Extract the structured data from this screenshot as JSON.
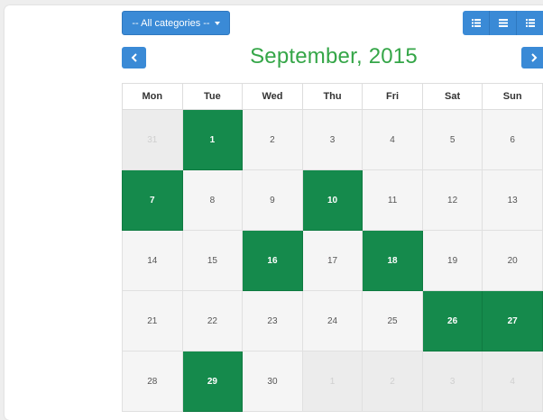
{
  "toolbar": {
    "category_label": "-- All categories --",
    "view_buttons": [
      "list-view-icon",
      "month-view-icon",
      "week-view-icon"
    ]
  },
  "calendar": {
    "title": "September, 2015",
    "weekdays": [
      "Mon",
      "Tue",
      "Wed",
      "Thu",
      "Fri",
      "Sat",
      "Sun"
    ],
    "weeks": [
      [
        {
          "d": "31",
          "other": true
        },
        {
          "d": "1",
          "event": true
        },
        {
          "d": "2"
        },
        {
          "d": "3"
        },
        {
          "d": "4"
        },
        {
          "d": "5"
        },
        {
          "d": "6"
        }
      ],
      [
        {
          "d": "7",
          "event": true
        },
        {
          "d": "8"
        },
        {
          "d": "9"
        },
        {
          "d": "10",
          "event": true
        },
        {
          "d": "11"
        },
        {
          "d": "12"
        },
        {
          "d": "13"
        }
      ],
      [
        {
          "d": "14"
        },
        {
          "d": "15"
        },
        {
          "d": "16",
          "event": true
        },
        {
          "d": "17"
        },
        {
          "d": "18",
          "event": true
        },
        {
          "d": "19"
        },
        {
          "d": "20"
        }
      ],
      [
        {
          "d": "21"
        },
        {
          "d": "22"
        },
        {
          "d": "23"
        },
        {
          "d": "24"
        },
        {
          "d": "25"
        },
        {
          "d": "26",
          "event": true
        },
        {
          "d": "27",
          "event": true
        }
      ],
      [
        {
          "d": "28"
        },
        {
          "d": "29",
          "event": true
        },
        {
          "d": "30"
        },
        {
          "d": "1",
          "other": true
        },
        {
          "d": "2",
          "other": true
        },
        {
          "d": "3",
          "other": true
        },
        {
          "d": "4",
          "other": true
        }
      ]
    ]
  },
  "colors": {
    "accent": "#3a8ad6",
    "title": "#35a648",
    "event": "#158a4c"
  }
}
